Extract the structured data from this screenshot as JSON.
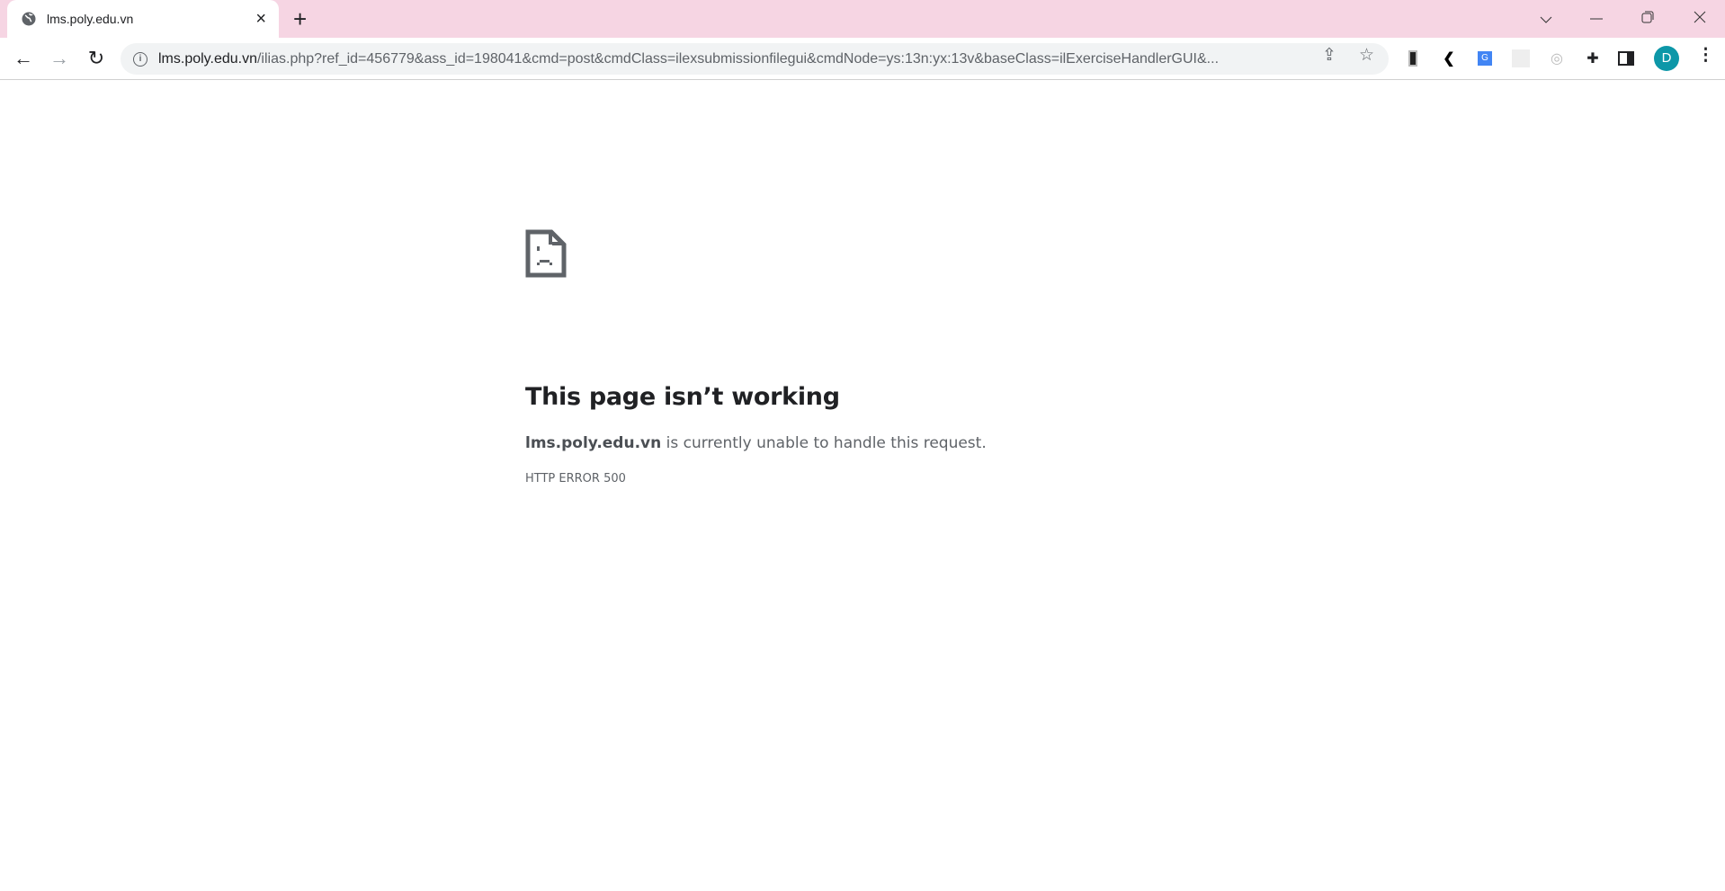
{
  "browser": {
    "tab": {
      "title": "lms.poly.edu.vn",
      "icon": "globe-icon",
      "close": "×"
    },
    "new_tab": "+",
    "url": {
      "host": "lms.poly.edu.vn",
      "path": "/ilias.php?ref_id=456779&ass_id=198041&cmd=post&cmdClass=ilexsubmissionfilegui&cmdNode=ys:13n:yx:13v&baseClass=ilExerciseHandlerGUI&..."
    },
    "profile_initial": "D",
    "accent": "#0d97a8"
  },
  "error": {
    "title": "This page isn’t working",
    "host": "lms.poly.edu.vn",
    "message": " is currently unable to handle this request.",
    "code": "HTTP ERROR 500"
  }
}
